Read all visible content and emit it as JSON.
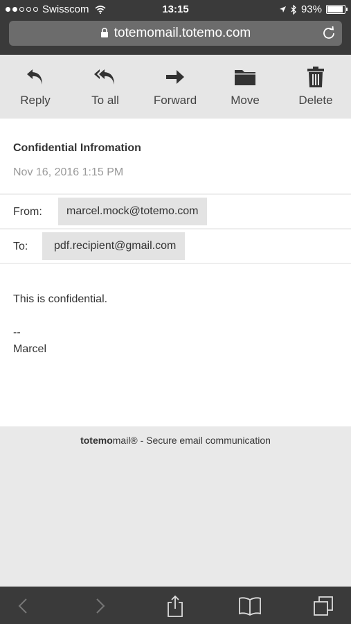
{
  "status_bar": {
    "carrier": "Swisscom",
    "time": "13:15",
    "battery": "93%"
  },
  "browser": {
    "url": "totemomail.totemo.com"
  },
  "toolbar": {
    "reply": "Reply",
    "reply_all": "To all",
    "forward": "Forward",
    "move": "Move",
    "delete": "Delete"
  },
  "message": {
    "subject": "Confidential Infromation",
    "date": "Nov 16, 2016 1:15 PM",
    "from_label": "From:",
    "from": "marcel.mock@totemo.com",
    "to_label": "To:",
    "to": "pdf.recipient@gmail.com",
    "body_line1": "This is confidential.",
    "signature_sep": "--",
    "signature_name": "Marcel"
  },
  "footer": {
    "brand_bold": "totemo",
    "brand_rest": "mail®",
    "tagline": " -  Secure email communication"
  }
}
